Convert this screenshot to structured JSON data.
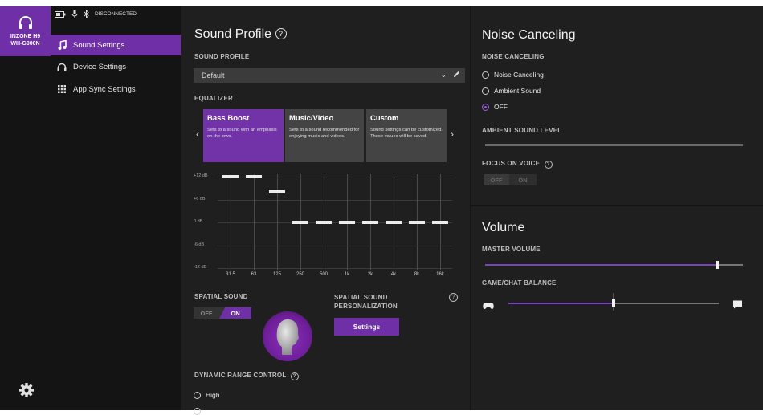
{
  "device": {
    "name_line1": "INZONE H9",
    "name_line2": "WH-G900N"
  },
  "status": {
    "connection": "DISCONNECTED"
  },
  "sidebar": {
    "items": [
      {
        "label": "Sound Settings",
        "icon": "music-note-icon"
      },
      {
        "label": "Device Settings",
        "icon": "headphones-icon"
      },
      {
        "label": "App Sync Settings",
        "icon": "grid-icon"
      }
    ]
  },
  "sound_profile": {
    "title": "Sound Profile",
    "profile_caption": "SOUND PROFILE",
    "selected": "Default",
    "equalizer_caption": "EQUALIZER",
    "presets": [
      {
        "title": "Bass Boost",
        "desc": "Sets to a sound with an emphasis on the lows."
      },
      {
        "title": "Music/Video",
        "desc": "Sets to a sound recommended for enjoying music and videos."
      },
      {
        "title": "Custom",
        "desc": "Sound settings can be customized. These values will be saved."
      }
    ],
    "eq_levels": [
      "+12 dB",
      "+6 dB",
      "0 dB",
      "-6 dB",
      "-12 dB"
    ],
    "eq_bands": [
      {
        "freq": "31.5",
        "db": 12
      },
      {
        "freq": "63",
        "db": 12
      },
      {
        "freq": "125",
        "db": 8
      },
      {
        "freq": "250",
        "db": 0
      },
      {
        "freq": "500",
        "db": 0
      },
      {
        "freq": "1k",
        "db": 0
      },
      {
        "freq": "2k",
        "db": 0
      },
      {
        "freq": "4k",
        "db": 0
      },
      {
        "freq": "8k",
        "db": 0
      },
      {
        "freq": "16k",
        "db": 0
      }
    ],
    "spatial_caption": "SPATIAL SOUND",
    "spatial_off": "OFF",
    "spatial_on": "ON",
    "personal_caption_1": "SPATIAL SOUND",
    "personal_caption_2": "PERSONALIZATION",
    "settings_button": "Settings",
    "drc_caption": "DYNAMIC RANGE CONTROL",
    "drc_options": [
      "High"
    ]
  },
  "noise": {
    "title": "Noise Canceling",
    "caption": "NOISE CANCELING",
    "options": [
      "Noise Canceling",
      "Ambient Sound",
      "OFF"
    ],
    "selected_index": 2,
    "ambient_caption": "AMBIENT SOUND LEVEL",
    "focus_caption": "FOCUS ON VOICE",
    "focus_off": "OFF",
    "focus_on": "ON"
  },
  "volume": {
    "title": "Volume",
    "master_caption": "MASTER VOLUME",
    "master_value": 0.9,
    "balance_caption": "GAME/CHAT BALANCE",
    "balance_value": 0.5
  },
  "colors": {
    "accent": "#6f2fa6",
    "panel": "#1f1f1f",
    "bg": "#141414"
  }
}
